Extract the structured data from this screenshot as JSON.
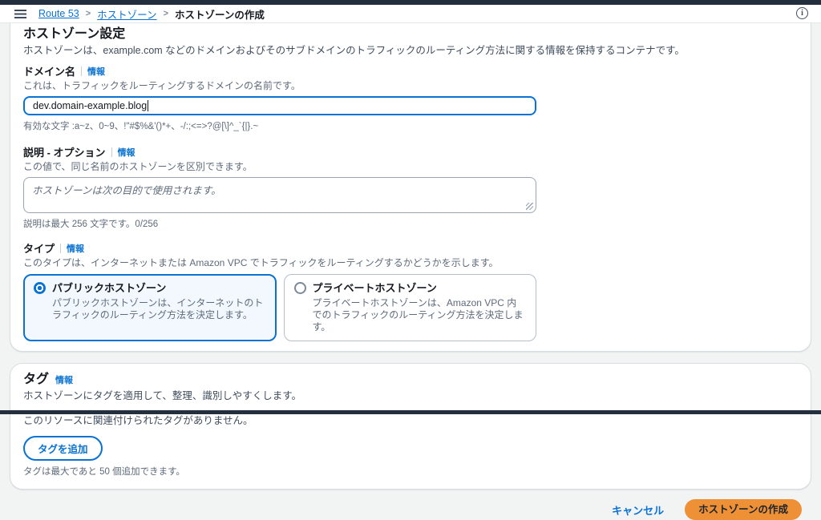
{
  "breadcrumb": {
    "separator": ">",
    "links": [
      "Route 53",
      "ホストゾーン"
    ],
    "current": "ホストゾーンの作成"
  },
  "settings_card": {
    "title": "ホストゾーン設定",
    "description": "ホストゾーンは、example.com などのドメインおよびそのサブドメインのトラフィックのルーティング方法に関する情報を保持するコンテナです。",
    "domain": {
      "label": "ドメイン名",
      "info_label": "情報",
      "description": "これは、トラフィックをルーティングするドメインの名前です。",
      "value": "dev.domain-example.blog",
      "constraint": "有効な文字 :a~z、0~9、!\"#$%&'()*+、-/:;<=>?@[\\]^_`{|}.~"
    },
    "note": {
      "label": "説明 - オプション",
      "info_label": "情報",
      "description": "この値で、同じ名前のホストゾーンを区別できます。",
      "placeholder": "ホストゾーンは次の目的で使用されます。",
      "constraint": "説明は最大 256 文字です。0/256"
    },
    "type": {
      "label": "タイプ",
      "info_label": "情報",
      "description": "このタイプは、インターネットまたは Amazon VPC でトラフィックをルーティングするかどうかを示します。",
      "options": [
        {
          "title": "パブリックホストゾーン",
          "description": "パブリックホストゾーンは、インターネットのトラフィックのルーティング方法を決定します。",
          "selected": true
        },
        {
          "title": "プライベートホストゾーン",
          "description": "プライベートホストゾーンは、Amazon VPC 内でのトラフィックのルーティング方法を決定します。",
          "selected": false
        }
      ]
    }
  },
  "tags_card": {
    "title": "タグ",
    "info_label": "情報",
    "description": "ホストゾーンにタグを適用して、整理、識別しやすくします。",
    "empty_message": "このリソースに関連付けられたタグがありません。",
    "add_button_label": "タグを追加",
    "constraint": "タグは最大であと 50 個追加できます。"
  },
  "footer": {
    "cancel_label": "キャンセル",
    "submit_label": "ホストゾーンの作成"
  },
  "colors": {
    "accent_blue": "#0972d3",
    "primary_button_orange": "#ee9036",
    "window_bar_navy": "#232f3e",
    "selected_tile_bg": "#f2f8fd"
  }
}
